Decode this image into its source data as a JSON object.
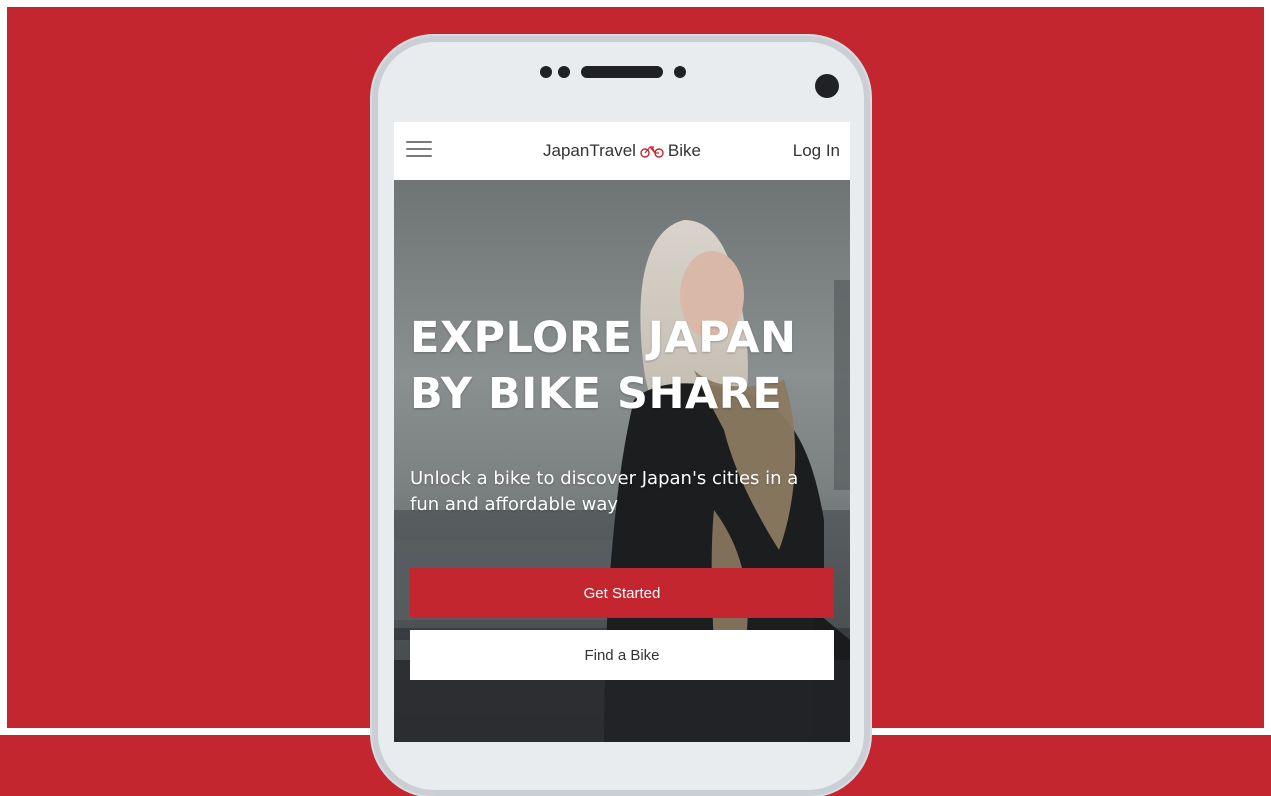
{
  "colors": {
    "brand_red": "#c4262f",
    "background": "#c4262f",
    "phone_frame": "#e8ecef"
  },
  "header": {
    "menu_icon": "hamburger-menu-icon",
    "logo_left": "JapanTravel",
    "logo_icon": "bicycle-icon",
    "logo_right": "Bike",
    "login_label": "Log In"
  },
  "hero": {
    "headline_line1": "EXPLORE JAPAN",
    "headline_line2": "BY BIKE SHARE",
    "subhead": "Unlock a bike to discover Japan's cities in a fun and affordable way",
    "cta_primary": "Get Started",
    "cta_secondary": "Find a Bike"
  }
}
